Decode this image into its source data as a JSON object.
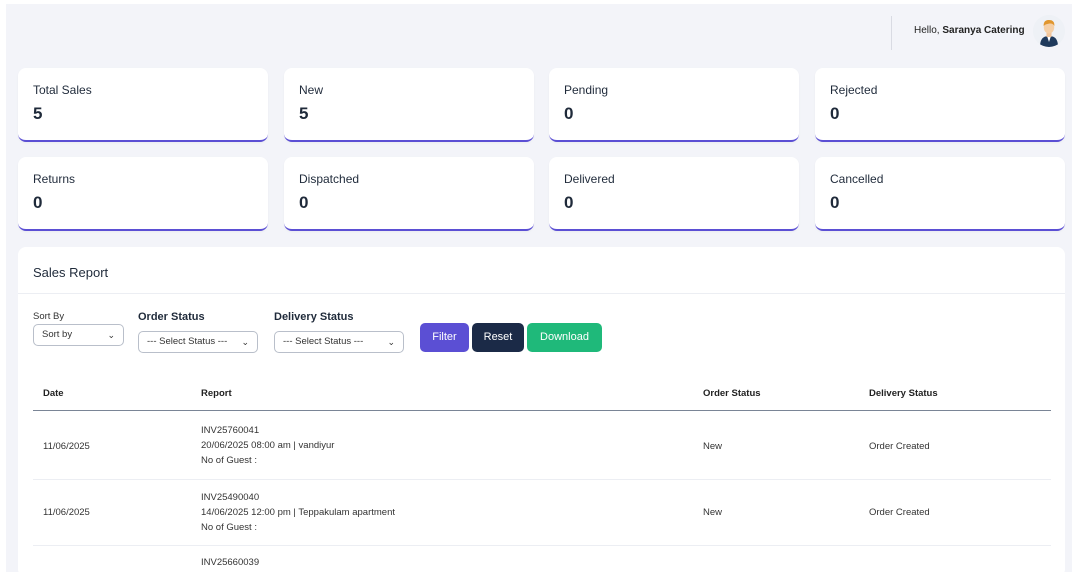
{
  "header": {
    "greeting_prefix": "Hello,",
    "user_name": "Saranya Catering"
  },
  "stats": [
    {
      "label": "Total Sales",
      "value": "5"
    },
    {
      "label": "New",
      "value": "5"
    },
    {
      "label": "Pending",
      "value": "0"
    },
    {
      "label": "Rejected",
      "value": "0"
    },
    {
      "label": "Returns",
      "value": "0"
    },
    {
      "label": "Dispatched",
      "value": "0"
    },
    {
      "label": "Delivered",
      "value": "0"
    },
    {
      "label": "Cancelled",
      "value": "0"
    }
  ],
  "report": {
    "title": "Sales Report",
    "filters": {
      "sort_by_label": "Sort By",
      "sort_by_value": "Sort by",
      "order_status_label": "Order Status",
      "order_status_value": "--- Select Status ---",
      "delivery_status_label": "Delivery Status",
      "delivery_status_value": "--- Select Status ---",
      "filter_label": "Filter",
      "reset_label": "Reset",
      "download_label": "Download"
    },
    "columns": [
      "Date",
      "Report",
      "Order Status",
      "Delivery Status"
    ],
    "rows": [
      {
        "date": "11/06/2025",
        "invoice": "INV25760041",
        "schedule": "20/06/2025 08:00 am | vandiyur",
        "guests": "No of Guest :",
        "order_status": "New",
        "delivery_status": "Order Created"
      },
      {
        "date": "11/06/2025",
        "invoice": "INV25490040",
        "schedule": "14/06/2025 12:00 pm | Teppakulam apartment",
        "guests": "No of Guest :",
        "order_status": "New",
        "delivery_status": "Order Created"
      },
      {
        "date": "",
        "invoice": "INV25660039",
        "schedule": "",
        "guests": "",
        "order_status": "",
        "delivery_status": ""
      }
    ]
  },
  "colors": {
    "accent": "#5b4fd4",
    "dark": "#1b2a47",
    "success": "#1fb97a",
    "background": "#f3f4f9"
  }
}
